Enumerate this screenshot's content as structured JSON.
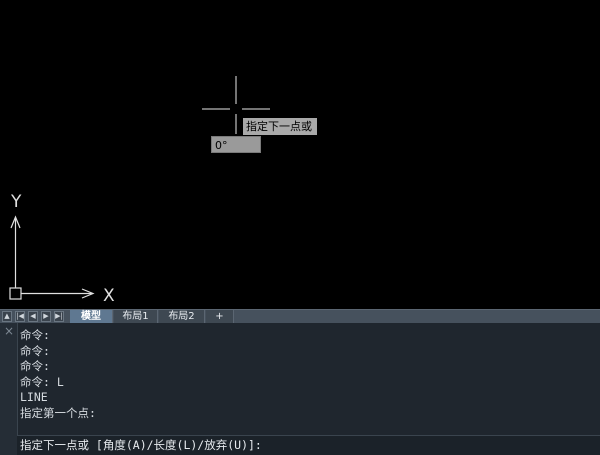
{
  "canvas": {
    "cursor_tooltip": "指定下一点或",
    "angle_value": "0°",
    "ucs": {
      "x_label": "X",
      "y_label": "Y"
    }
  },
  "tabs": {
    "nav": [
      "▲",
      "|◀",
      "◀",
      "▶",
      "▶|"
    ],
    "items": [
      {
        "label": "模型",
        "active": true
      },
      {
        "label": "布局1",
        "active": false
      },
      {
        "label": "布局2",
        "active": false
      },
      {
        "label": "+",
        "active": false
      }
    ]
  },
  "command": {
    "close_icon": "×",
    "history": [
      "命令:",
      "命令:",
      "命令:",
      "命令: L",
      "LINE",
      "指定第一个点:"
    ],
    "prompt": "指定下一点或 [角度(A)/长度(L)/放弃(U)]:"
  },
  "colors": {
    "canvas_bg": "#000000",
    "panel_bg": "#1f262e",
    "tab_active": "#5f7891",
    "tooltip_bg": "#a9a9a9"
  }
}
